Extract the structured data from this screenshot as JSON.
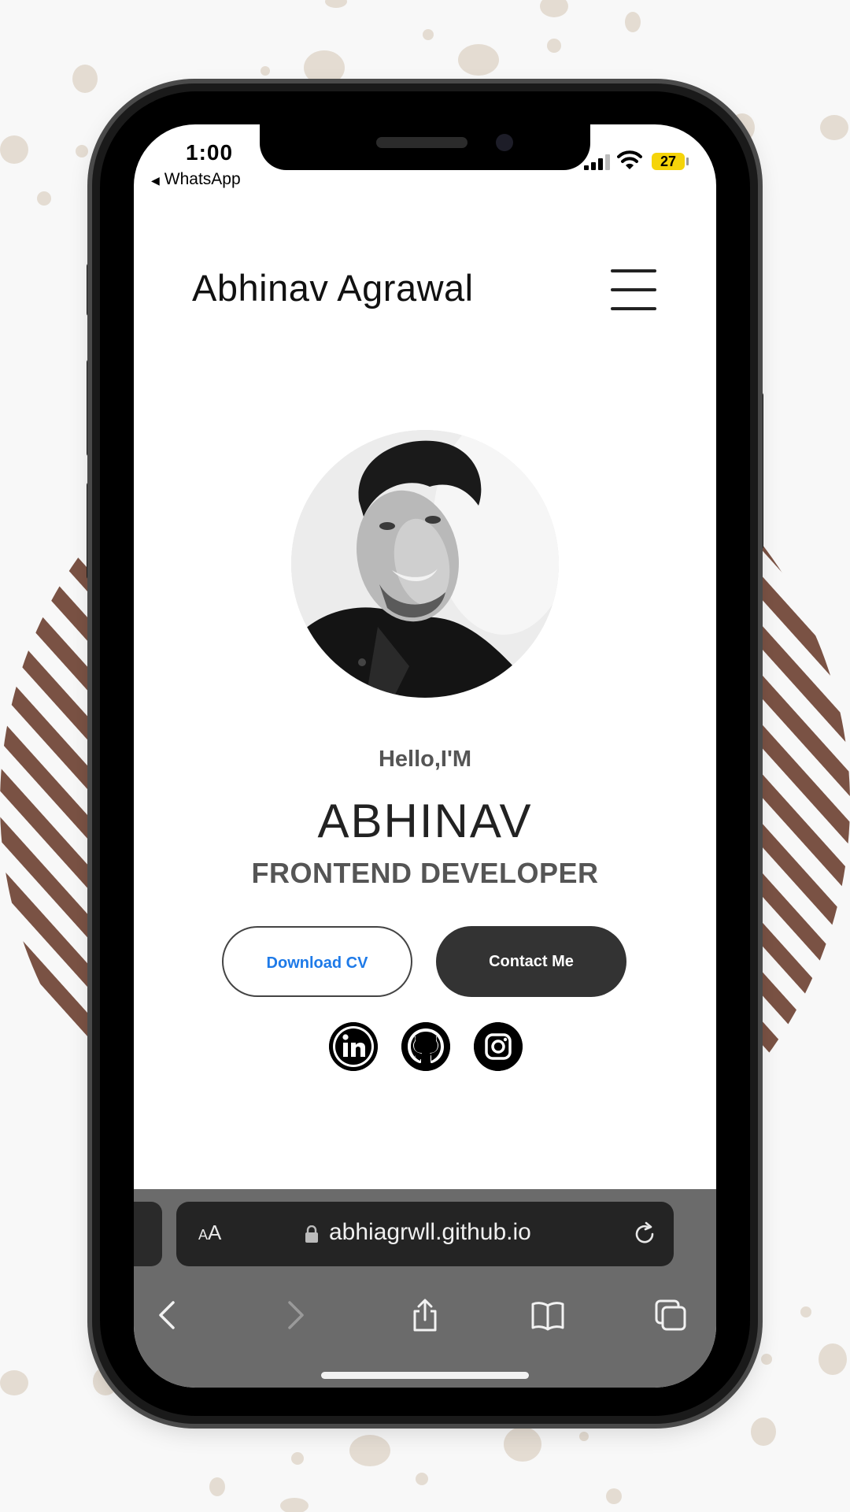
{
  "status_bar": {
    "time": "1:00",
    "back_app": "WhatsApp",
    "battery": "27"
  },
  "header": {
    "title": "Abhinav Agrawal"
  },
  "hero": {
    "greeting": "Hello,I'M",
    "name": "ABHINAV",
    "role": "FRONTEND DEVELOPER",
    "download_cv": "Download CV",
    "contact_me": "Contact Me"
  },
  "socials": [
    "linkedin-icon",
    "github-icon",
    "instagram-icon"
  ],
  "browser": {
    "text_size_label": "AA",
    "url": "abhiagrwll.github.io"
  },
  "colors": {
    "accent_blue": "#1e7ae8",
    "button_dark": "#333333",
    "stripe_brown": "#7a5244",
    "spot_beige": "#e4dcd2"
  }
}
